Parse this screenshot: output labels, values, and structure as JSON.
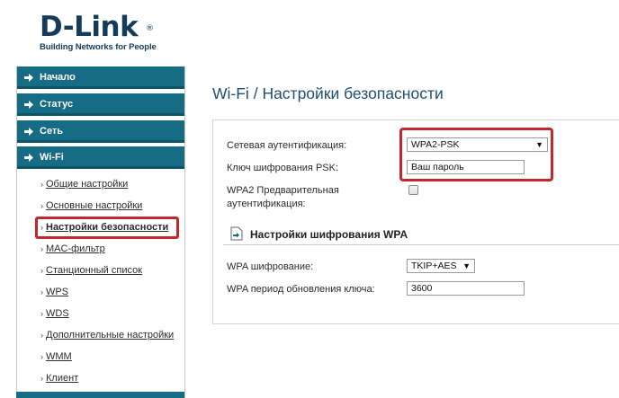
{
  "brand": {
    "name": "D-Link",
    "registered": "®",
    "tagline": "Building Networks for People"
  },
  "sidebar": {
    "sections": [
      {
        "label": "Начало"
      },
      {
        "label": "Статус"
      },
      {
        "label": "Сеть"
      },
      {
        "label": "Wi-Fi"
      }
    ],
    "wifi_items": [
      {
        "label": "Общие настройки"
      },
      {
        "label": "Основные настройки"
      },
      {
        "label": "Настройки безопасности",
        "active": true
      },
      {
        "label": "MAC-фильтр"
      },
      {
        "label": "Станционный список"
      },
      {
        "label": "WPS"
      },
      {
        "label": "WDS"
      },
      {
        "label": "Дополнительные настройки"
      },
      {
        "label": "WMM"
      },
      {
        "label": "Клиент"
      }
    ],
    "bullet": "›"
  },
  "main": {
    "breadcrumb": "Wi-Fi",
    "separator": "/",
    "title": "Настройки безопасности",
    "auth_label": "Сетевая аутентификация:",
    "auth_value": "WPA2-PSK",
    "psk_label": "Ключ шифрования PSK:",
    "psk_value": "Ваш пароль",
    "preauth_label_line1": "WPA2 Предварительная",
    "preauth_label_line2": "аутентификация:",
    "preauth_checked": false,
    "wpa_section_title": "Настройки шифрования WPA",
    "wpa_enc_label": "WPA шифрование:",
    "wpa_enc_value": "TKIP+AES",
    "wpa_renew_label": "WPA период обновления ключа:",
    "wpa_renew_value": "3600"
  },
  "colors": {
    "nav": "#156c84",
    "highlight": "#c1272d",
    "title": "#1f4f73",
    "logo": "#143b5a"
  },
  "icons": {
    "nav_arrow": "arrow-right-icon",
    "dropdown": "triangle-down-icon",
    "section": "document-arrow-icon"
  }
}
